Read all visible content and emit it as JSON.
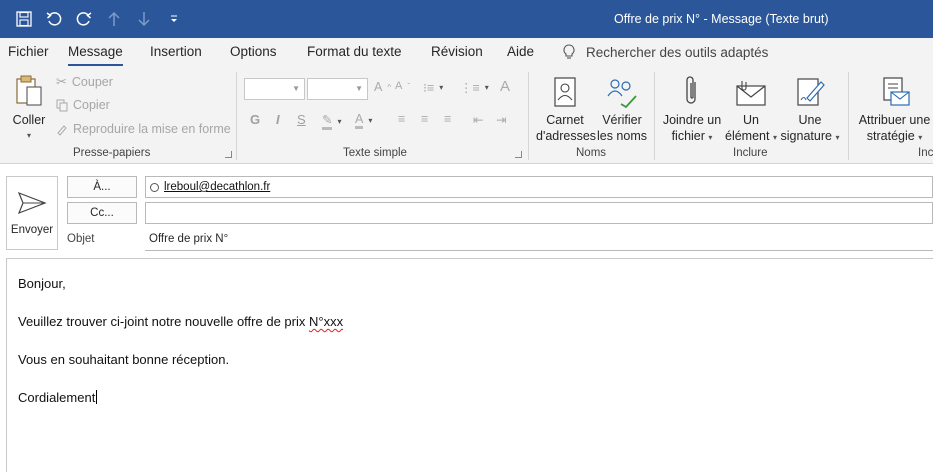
{
  "titlebar": {
    "title": "Offre de prix N°  -  Message (Texte brut)",
    "bg": "#2b579a"
  },
  "tabs": [
    "Fichier",
    "Message",
    "Insertion",
    "Options",
    "Format du texte",
    "Révision",
    "Aide"
  ],
  "active_tab": "Message",
  "tell_me": "Rechercher des outils adaptés",
  "clipboard": {
    "paste": "Coller",
    "cut": "Couper",
    "copy": "Copier",
    "format_painter": "Reproduire la mise en forme",
    "label": "Presse-papiers"
  },
  "basic_text": {
    "label": "Texte simple",
    "bold": "G",
    "italic": "I",
    "underline": "S"
  },
  "names": {
    "address_book_1": "Carnet",
    "address_book_2": "d'adresses",
    "check_names_1": "Vérifier",
    "check_names_2": "les noms",
    "label": "Noms"
  },
  "include": {
    "attach_file_1": "Joindre un",
    "attach_file_2": "fichier",
    "attach_item_1": "Un",
    "attach_item_2": "élément",
    "signature_1": "Une",
    "signature_2": "signature",
    "label": "Inclure"
  },
  "tags": {
    "assign_policy_1": "Attribuer une",
    "assign_policy_2": "stratégie",
    "label": "Inc"
  },
  "compose": {
    "send": "Envoyer",
    "to_label": "À...",
    "cc_label": "Cc...",
    "subject_label": "Objet",
    "to_value": "lreboul@decathlon.fr",
    "cc_value": "",
    "subject_value": "Offre de prix N°"
  },
  "body": {
    "line1": "Bonjour,",
    "line2_a": "Veuillez trouver ci-joint notre nouvelle offre de prix ",
    "line2_b": "N°xxx",
    "line3": "Vous en souhaitant bonne réception.",
    "line4": "Cordialement"
  }
}
